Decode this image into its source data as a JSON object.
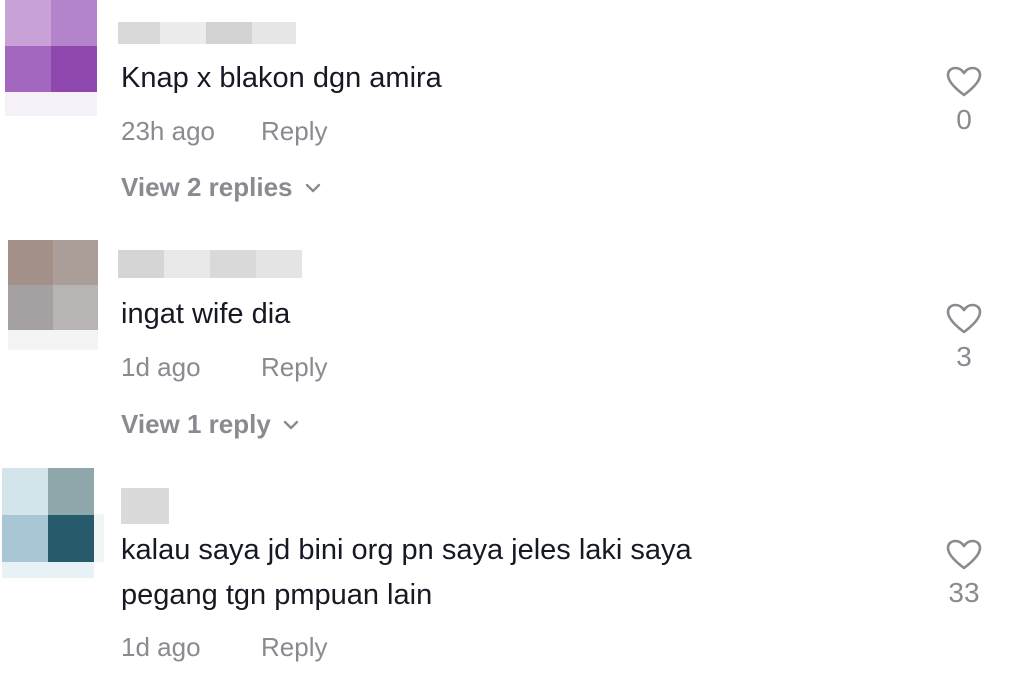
{
  "comments": [
    {
      "text": "Knap x blakon dgn amira",
      "time": "23h ago",
      "reply_label": "Reply",
      "view_replies": "View 2 replies",
      "likes": "0"
    },
    {
      "text": "ingat wife dia",
      "time": "1d ago",
      "reply_label": "Reply",
      "view_replies": "View 1 reply",
      "likes": "3"
    },
    {
      "text_line1": "kalau saya jd bini org pn saya jeles laki saya",
      "text_line2": "pegang tgn pmpuan lain",
      "time": "1d ago",
      "reply_label": "Reply",
      "likes": "33"
    }
  ],
  "colors": {
    "text_primary": "#161823",
    "text_secondary": "#8a8b91",
    "icon": "#8a8b91"
  },
  "icons": {
    "like": "heart-outline-icon",
    "expand": "chevron-down-icon"
  }
}
